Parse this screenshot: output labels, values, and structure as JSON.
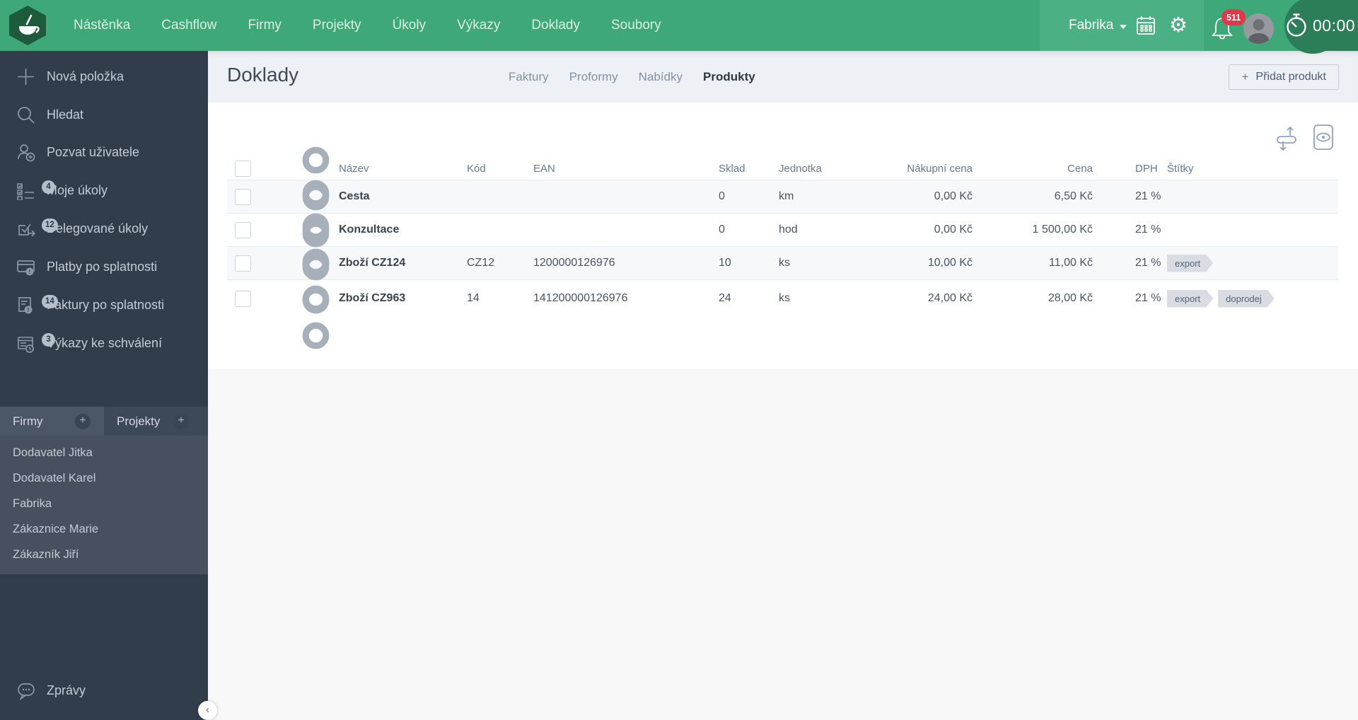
{
  "colors": {
    "topbar_green": "#3EA878",
    "topbar_dark_green": "#2B7E58",
    "topbar_light_green": "#4BB083",
    "sidebar_bg": "#323D4C",
    "notification_red": "#E23748"
  },
  "topbar": {
    "nav": [
      {
        "label": "Nástěnka"
      },
      {
        "label": "Cashflow"
      },
      {
        "label": "Firmy"
      },
      {
        "label": "Projekty"
      },
      {
        "label": "Úkoly"
      },
      {
        "label": "Výkazy"
      },
      {
        "label": "Doklady"
      },
      {
        "label": "Soubory"
      }
    ],
    "account_label": "Fabrika",
    "gear_glyph": "⚙",
    "notification_count": "511",
    "timer_value": "00:00"
  },
  "sidebar": {
    "items": [
      {
        "label": "Nová položka",
        "badge": ""
      },
      {
        "label": "Hledat",
        "badge": ""
      },
      {
        "label": "Pozvat uživatele",
        "badge": ""
      },
      {
        "label": "Moje úkoly",
        "badge": "4"
      },
      {
        "label": "Delegované úkoly",
        "badge": "12"
      },
      {
        "label": "Platby po splatnosti",
        "badge": ""
      },
      {
        "label": "Faktury po splatnosti",
        "badge": "14"
      },
      {
        "label": "Výkazy ke schválení",
        "badge": "3"
      }
    ],
    "tabs": [
      {
        "label": "Firmy",
        "add": "+"
      },
      {
        "label": "Projekty",
        "add": "+"
      }
    ],
    "companies": [
      "Dodavatel Jitka",
      "Dodavatel Karel",
      "Fabrika",
      "Zákaznice Marie",
      "Zákazník Jiří"
    ],
    "messages_label": "Zprávy",
    "collapse_glyph": "‹"
  },
  "page": {
    "title": "Doklady",
    "tabs": [
      {
        "label": "Faktury"
      },
      {
        "label": "Proformy"
      },
      {
        "label": "Nabídky"
      },
      {
        "label": "Produkty"
      }
    ],
    "active_tab": "Produkty",
    "add_button_plus": "+",
    "add_button_label": "Přidat produkt"
  },
  "table": {
    "headers": {
      "name": "Název",
      "code": "Kód",
      "ean": "EAN",
      "stock": "Sklad",
      "unit": "Jednotka",
      "purchase": "Nákupní cena",
      "price": "Cena",
      "vat": "DPH",
      "tags": "Štítky"
    },
    "rows": [
      {
        "name": "Cesta",
        "code": "",
        "ean": "",
        "stock": "0",
        "unit": "km",
        "purchase_price": "0,00 Kč",
        "price": "6,50 Kč",
        "vat": "21 %",
        "tags": {}
      },
      {
        "name": "Konzultace",
        "code": "",
        "ean": "",
        "stock": "0",
        "unit": "hod",
        "purchase_price": "0,00 Kč",
        "price": "1 500,00 Kč",
        "vat": "21 %",
        "tags": {}
      },
      {
        "name": "Zboží CZ124",
        "code": "CZ12",
        "ean": "1200000126976",
        "stock": "10",
        "unit": "ks",
        "purchase_price": "10,00 Kč",
        "price": "11,00 Kč",
        "vat": "21 %",
        "tags": {
          "0": "export"
        }
      },
      {
        "name": "Zboží CZ963",
        "code": "14",
        "ean": "141200000126976",
        "stock": "24",
        "unit": "ks",
        "purchase_price": "24,00 Kč",
        "price": "28,00 Kč",
        "vat": "21 %",
        "tags": {
          "0": "export",
          "1": "doprodej"
        }
      }
    ]
  }
}
